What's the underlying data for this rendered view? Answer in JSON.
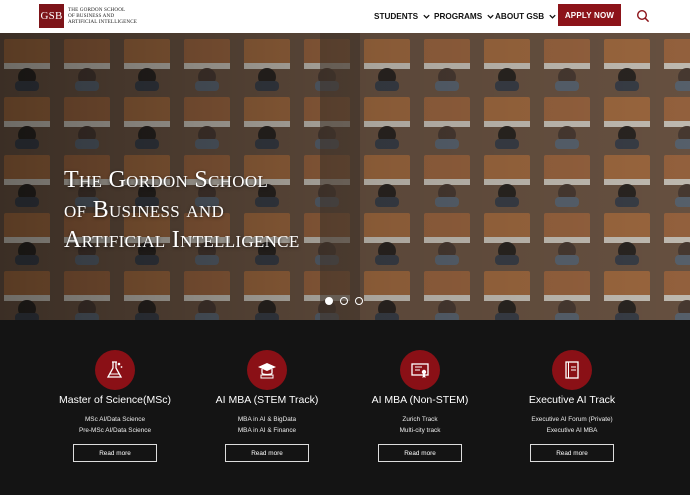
{
  "brand": {
    "mark": "GSB",
    "lines": [
      "The Gordon School",
      "of Business and",
      "Artificial Intelligence"
    ],
    "accent": "#8c1319"
  },
  "nav": {
    "students": "STUDENTS",
    "programs": "PROGRAMS",
    "about": "ABOUT GSB",
    "apply": "APPLY NOW"
  },
  "hero": {
    "title_lines": [
      "The Gordon School",
      "of Business and",
      "Artificial Intelligence"
    ],
    "slide_count": 3,
    "active_slide": 1
  },
  "programs": [
    {
      "title": "Master of Science(MSc)",
      "lines": [
        "MSc AI/Data Science",
        "Pre-MSc AI/Data Science"
      ],
      "button": "Read more",
      "icon": "flask-icon"
    },
    {
      "title": "AI MBA (STEM Track)",
      "lines": [
        "MBA in AI & BigData",
        "MBA in AI & Finance"
      ],
      "button": "Read more",
      "icon": "graduation-cap-icon"
    },
    {
      "title": "AI MBA (Non-STEM)",
      "lines": [
        "Zurich Track",
        "Multi-city track"
      ],
      "button": "Read more",
      "icon": "certificate-icon"
    },
    {
      "title": "Executive AI Track",
      "lines": [
        "Executive AI Forum (Private)",
        "Executive AI MBA"
      ],
      "button": "Read more",
      "icon": "book-icon"
    }
  ]
}
